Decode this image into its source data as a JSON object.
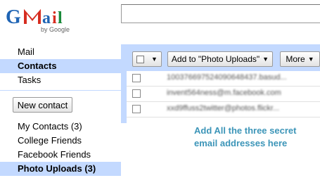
{
  "logo": {
    "wordmark": "Gmail",
    "byline": "by Google"
  },
  "search": {
    "value": "",
    "placeholder": ""
  },
  "nav": {
    "items": [
      {
        "label": "Mail"
      },
      {
        "label": "Contacts"
      },
      {
        "label": "Tasks"
      }
    ],
    "new_contact_label": "New contact"
  },
  "groups": [
    {
      "label": "My Contacts (3)"
    },
    {
      "label": "College Friends"
    },
    {
      "label": "Facebook Friends"
    },
    {
      "label": "Photo Uploads (3)"
    }
  ],
  "toolbar": {
    "add_label": "Add to \"Photo Uploads\"",
    "more_label": "More",
    "dropdown_arrow": "▼"
  },
  "contacts": [
    {
      "email": "100376697524090648437.basud..."
    },
    {
      "email": "invent564ness@m.facebook.com"
    },
    {
      "email": "xxd9ffuss2twitter@photos.flickr..."
    }
  ],
  "annotation": {
    "line1": "Add All the three secret",
    "line2": "email addresses here"
  },
  "colors": {
    "selection_blue": "#c3d9ff",
    "annotation_teal": "#3c95b8",
    "gmail_red": "#d62d20",
    "google_blue": "#1f64b4"
  }
}
